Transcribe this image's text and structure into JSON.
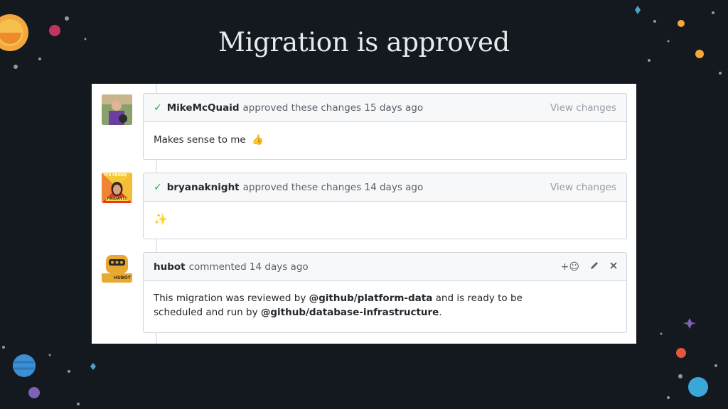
{
  "slide": {
    "title": "Migration is approved"
  },
  "timeline": [
    {
      "author": "MikeMcQuaid",
      "action": "approved these changes 15 days ago",
      "view_label": "View changes",
      "body": "Makes sense to me",
      "body_emoji": "👍"
    },
    {
      "author": "bryanaknight",
      "action": "approved these changes 14 days ago",
      "view_label": "View changes",
      "body_emoji": "✨",
      "avatar_text_top": "IT'S FRIDAY",
      "avatar_text_bottom": "FRIDAY!!!"
    },
    {
      "author": "hubot",
      "action": "commented 14 days ago",
      "add_reaction_glyph": "+☺",
      "body_part1": "This migration was reviewed by ",
      "mention1": "@github/platform-data",
      "body_part2": " and is ready to be",
      "body_part3": "scheduled and run by ",
      "mention2": "@github/database-infrastructure",
      "body_part4": ".",
      "avatar_text": "HUBOT"
    }
  ],
  "icons": {
    "check": "check-icon",
    "add_reaction": "smiley-icon",
    "edit": "pencil-icon",
    "delete": "close-icon"
  }
}
